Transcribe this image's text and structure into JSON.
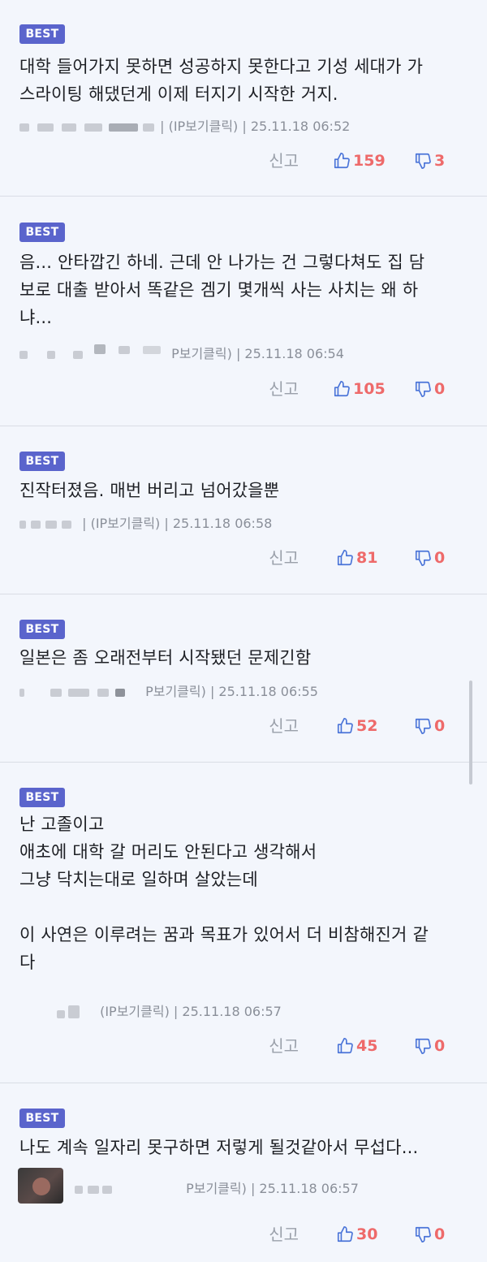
{
  "comments": [
    {
      "badge": "BEST",
      "text": "대학 들어가지 못하면 성공하지 못한다고 기성 세대가 가\n스라이팅 해댔던게 이제 터지기 시작한 거지.",
      "meta": "| (IP보기클릭) | 25.11.18 06:52",
      "report": "신고",
      "likes": "159",
      "dislikes": "3"
    },
    {
      "badge": "BEST",
      "text": "음... 안타깝긴 하네. 근데 안 나가는 건 그렇다쳐도 집 담\n보로 대출 받아서 똑같은 겜기 몇개씩 사는 사치는 왜 하\n냐...",
      "meta": "P보기클릭) | 25.11.18 06:54",
      "report": "신고",
      "likes": "105",
      "dislikes": "0"
    },
    {
      "badge": "BEST",
      "text": "진작터졌음. 매번 버리고 넘어갔을뿐",
      "meta": "| (IP보기클릭) | 25.11.18 06:58",
      "report": "신고",
      "likes": "81",
      "dislikes": "0"
    },
    {
      "badge": "BEST",
      "text": "일본은 좀 오래전부터 시작됐던 문제긴함",
      "meta": "P보기클릭) | 25.11.18 06:55",
      "report": "신고",
      "likes": "52",
      "dislikes": "0"
    },
    {
      "badge": "BEST",
      "text": "난 고졸이고\n애초에 대학 갈 머리도 안된다고 생각해서\n그냥 닥치는대로 일하며 살았는데\n\n이 사연은 이루려는 꿈과 목표가 있어서 더 비참해진거 같\n다",
      "meta": "(IP보기클릭) | 25.11.18 06:57",
      "report": "신고",
      "likes": "45",
      "dislikes": "0"
    },
    {
      "badge": "BEST",
      "text": "나도 계속 일자리 못구하면 저렇게 될것같아서 무섭다...",
      "meta": "P보기클릭) | 25.11.18 06:57",
      "report": "신고",
      "likes": "30",
      "dislikes": "0"
    }
  ],
  "colors": {
    "background": "#f3f6fc",
    "badge": "#5a64cc",
    "thumb_icon": "#4a74d8",
    "count": "#ee6a6a"
  },
  "icons": {
    "like": "thumbs-up-icon",
    "dislike": "thumbs-down-icon"
  }
}
